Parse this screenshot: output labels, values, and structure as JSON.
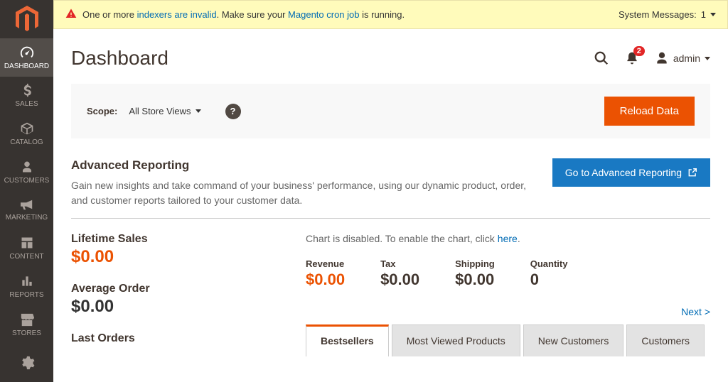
{
  "sidebar": {
    "items": [
      {
        "label": "DASHBOARD"
      },
      {
        "label": "SALES"
      },
      {
        "label": "CATALOG"
      },
      {
        "label": "CUSTOMERS"
      },
      {
        "label": "MARKETING"
      },
      {
        "label": "CONTENT"
      },
      {
        "label": "REPORTS"
      },
      {
        "label": "STORES"
      }
    ]
  },
  "sys_msg": {
    "text1": "One or more ",
    "link1": "indexers are invalid",
    "text2": ". Make sure your ",
    "link2": "Magento cron job",
    "text3": " is running.",
    "right_label": "System Messages:",
    "right_count": "1"
  },
  "header": {
    "title": "Dashboard",
    "notif_count": "2",
    "user_label": "admin"
  },
  "scope": {
    "label": "Scope:",
    "value": "All Store Views",
    "reload_btn": "Reload Data"
  },
  "adv_report": {
    "title": "Advanced Reporting",
    "desc": "Gain new insights and take command of your business' performance, using our dynamic product, order, and customer reports tailored to your customer data.",
    "btn": "Go to Advanced Reporting"
  },
  "stats": {
    "lifetime_title": "Lifetime Sales",
    "lifetime_value": "$0.00",
    "avg_title": "Average Order",
    "avg_value": "$0.00",
    "last_orders_title": "Last Orders"
  },
  "chart": {
    "msg1": "Chart is disabled. To enable the chart, click ",
    "link": "here",
    "msg2": ".",
    "kpis": [
      {
        "label": "Revenue",
        "value": "$0.00"
      },
      {
        "label": "Tax",
        "value": "$0.00"
      },
      {
        "label": "Shipping",
        "value": "$0.00"
      },
      {
        "label": "Quantity",
        "value": "0"
      }
    ],
    "next": "Next >"
  },
  "tabs": [
    {
      "label": "Bestsellers"
    },
    {
      "label": "Most Viewed Products"
    },
    {
      "label": "New Customers"
    },
    {
      "label": "Customers"
    }
  ]
}
